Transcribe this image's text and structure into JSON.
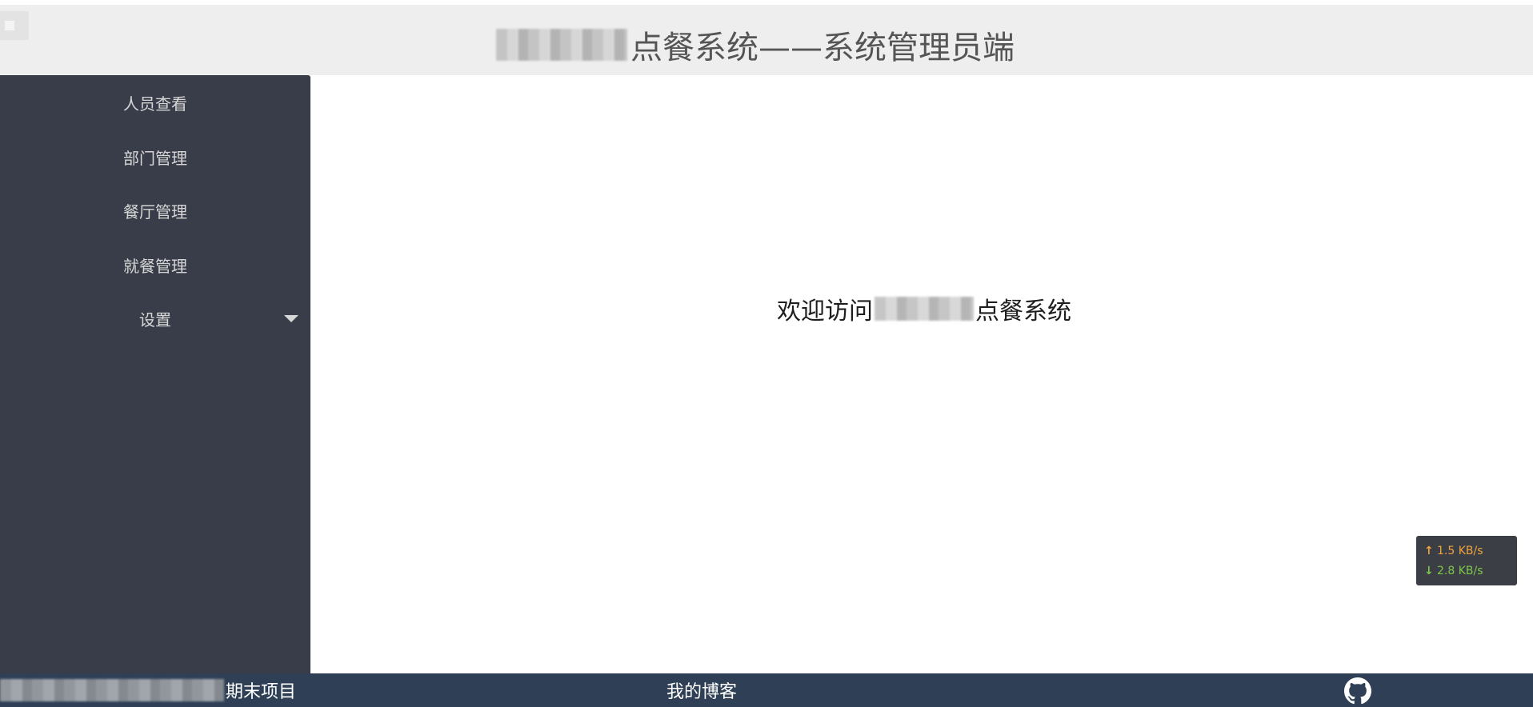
{
  "header": {
    "title_suffix": "点餐系统——系统管理员端"
  },
  "sidebar": {
    "items": [
      {
        "label": "人员查看"
      },
      {
        "label": "部门管理"
      },
      {
        "label": "餐厅管理"
      },
      {
        "label": "就餐管理"
      },
      {
        "label": "设置",
        "has_dropdown": true
      }
    ]
  },
  "main": {
    "welcome_prefix": "欢迎访问",
    "welcome_suffix": "点餐系统"
  },
  "netspeed": {
    "upload": "1.5 KB/s",
    "download": "2.8 KB/s",
    "up_arrow": "↑",
    "down_arrow": "↓"
  },
  "footer": {
    "project_suffix": "期末项目",
    "blog_link": "我的博客",
    "github_icon": "github-icon"
  },
  "colors": {
    "header_bg": "#eeeeee",
    "sidebar_bg": "#393d49",
    "footer_bg": "#2f4056",
    "upload_color": "#f0a43c",
    "download_color": "#7dc84a"
  }
}
